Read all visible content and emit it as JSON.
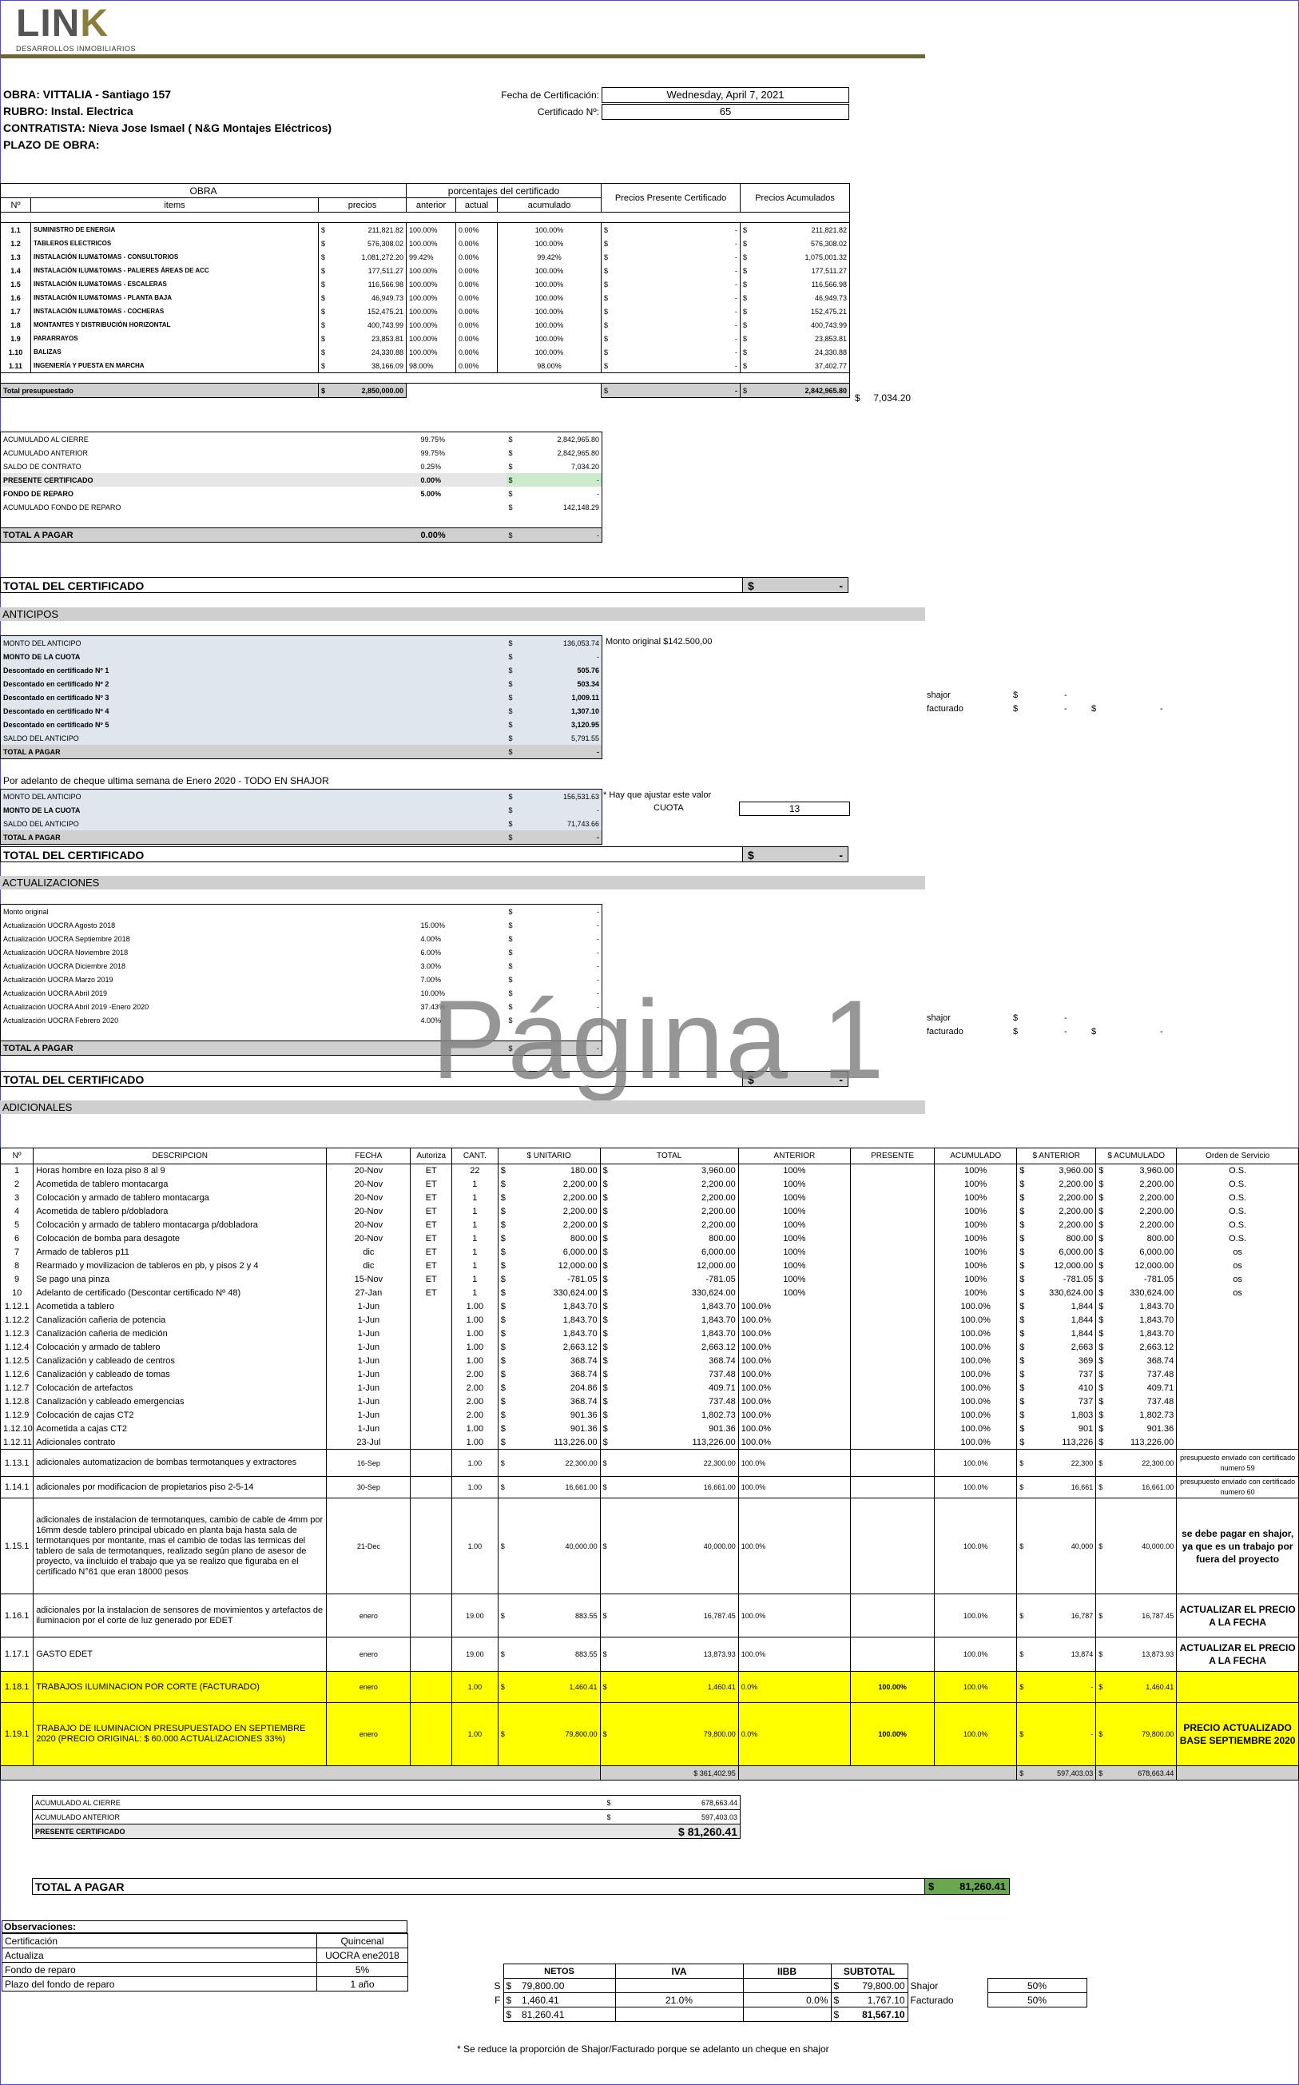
{
  "logo": {
    "name": "LINK",
    "sub": "DESARROLLOS INMOBILIARIOS"
  },
  "header": {
    "obra": "OBRA: VITTALIA - Santiago 157",
    "rubro": "RUBRO: Instal. Electrica",
    "contratista": "CONTRATISTA: Nieva Jose Ismael ( N&G Montajes Eléctricos)",
    "plazo": "PLAZO DE OBRA:",
    "fecha_label": "Fecha de Certificación:",
    "fecha": "Wednesday, April 7, 2021",
    "cert_label": "Certificado Nº:",
    "cert": "65"
  },
  "obra_table": {
    "h_obra": "OBRA",
    "h_porc": "porcentajes del certificado",
    "h_presente": "Precios Presente Certificado",
    "h_acum": "Precios Acumulados",
    "cols": [
      "Nº",
      "items",
      "precios",
      "anterior",
      "actual",
      "acumulado"
    ],
    "rows": [
      [
        "1.1",
        "SUMINISTRO DE ENERGIA",
        "211,821.82",
        "100.00%",
        "0.00%",
        "100.00%",
        "-",
        "211,821.82"
      ],
      [
        "1.2",
        "TABLEROS ELECTRICOS",
        "576,308.02",
        "100.00%",
        "0.00%",
        "100.00%",
        "-",
        "576,308.02"
      ],
      [
        "1.3",
        "INSTALACIÓN ILUM&TOMAS - CONSULTORIOS",
        "1,081,272.20",
        "99.42%",
        "0.00%",
        "99.42%",
        "-",
        "1,075,001.32"
      ],
      [
        "1.4",
        "INSTALACIÓN ILUM&TOMAS - PALIERES ÁREAS DE ACC",
        "177,511.27",
        "100.00%",
        "0.00%",
        "100.00%",
        "-",
        "177,511.27"
      ],
      [
        "1.5",
        "INSTALACIÓN ILUM&TOMAS - ESCALERAS",
        "116,566.98",
        "100.00%",
        "0.00%",
        "100.00%",
        "-",
        "116,566.98"
      ],
      [
        "1.6",
        "INSTALACIÓN ILUM&TOMAS - PLANTA BAJA",
        "46,949.73",
        "100.00%",
        "0.00%",
        "100.00%",
        "-",
        "46,949.73"
      ],
      [
        "1.7",
        "INSTALACIÓN ILUM&TOMAS - COCHERAS",
        "152,475.21",
        "100.00%",
        "0.00%",
        "100.00%",
        "-",
        "152,475.21"
      ],
      [
        "1.8",
        "MONTANTES Y DISTRIBUCIÓN HORIZONTAL",
        "400,743.99",
        "100.00%",
        "0.00%",
        "100.00%",
        "-",
        "400,743.99"
      ],
      [
        "1.9",
        "PARARRAYOS",
        "23,853.81",
        "100.00%",
        "0.00%",
        "100.00%",
        "-",
        "23,853.81"
      ],
      [
        "1.10",
        "BALIZAS",
        "24,330.88",
        "100.00%",
        "0.00%",
        "100.00%",
        "-",
        "24,330.88"
      ],
      [
        "1.11",
        "INGENIERÍA Y PUESTA EN MARCHA",
        "38,166.09",
        "98.00%",
        "0.00%",
        "98.00%",
        "-",
        "37,402.77"
      ]
    ],
    "total_label": "Total presupuestado",
    "total_precio": "2,850,000.00",
    "total_presente": "-",
    "total_acum": "2,842,965.80",
    "saldo": "7,034.20"
  },
  "resumen": [
    {
      "label": "ACUMULADO AL CIERRE",
      "pct": "99.75%",
      "amt": "2,842,965.80"
    },
    {
      "label": "ACUMULADO ANTERIOR",
      "pct": "99.75%",
      "amt": "2,842,965.80"
    },
    {
      "label": "SALDO DE CONTRATO",
      "pct": "0.25%",
      "amt": "7,034.20"
    },
    {
      "label": "PRESENTE CERTIFICADO",
      "pct": "0.00%",
      "amt": "-"
    },
    {
      "label": "FONDO DE REPARO",
      "pct": "5.00%",
      "amt": "-"
    },
    {
      "label": "ACUMULADO FONDO DE REPARO",
      "pct": "",
      "amt": "142,148.29"
    }
  ],
  "total_pagar": {
    "label": "TOTAL A PAGAR",
    "pct": "0.00%",
    "amt": "-"
  },
  "total_cert": {
    "label": "TOTAL DEL CERTIFICADO",
    "amt": "-"
  },
  "currency": "$",
  "anticipos": {
    "title": "ANTICIPOS",
    "original": "Monto original $142.500,00",
    "rows": [
      {
        "label": "MONTO DEL ANTICIPO",
        "amt": "136,053.74"
      },
      {
        "label": "MONTO DE LA CUOTA",
        "amt": "-"
      },
      {
        "label": "Descontado en certificado Nº 1",
        "amt": "505.76"
      },
      {
        "label": "Descontado en certificado Nº 2",
        "amt": "503.34"
      },
      {
        "label": "Descontado en certificado Nº 3",
        "amt": "1,009.11"
      },
      {
        "label": "Descontado en certificado Nº 4",
        "amt": "1,307.10"
      },
      {
        "label": "Descontado en certificado Nº 5",
        "amt": "3,120.95"
      },
      {
        "label": "SALDO DEL ANTICIPO",
        "amt": "5,791.55"
      },
      {
        "label": "TOTAL A PAGAR",
        "amt": "-"
      }
    ],
    "shajor": "shajor",
    "facturado": "facturado",
    "dash": "-",
    "cheque_note": "Por adelanto de cheque ultima semana de Enero 2020 - TODO EN SHAJOR",
    "rows2": [
      {
        "label": "MONTO DEL ANTICIPO",
        "amt": "156,531.63"
      },
      {
        "label": "MONTO DE LA CUOTA",
        "amt": "-"
      },
      {
        "label": "SALDO DEL ANTICIPO",
        "amt": "71,743.66"
      },
      {
        "label": "TOTAL A PAGAR",
        "amt": "-"
      }
    ],
    "ajustar": "* Hay que ajustar este valor",
    "cuota_label": "CUOTA",
    "cuota": "13",
    "total_label": "TOTAL DEL CERTIFICADO",
    "total_amt": "-"
  },
  "actualizaciones": {
    "title": "ACTUALIZACIONES",
    "rows": [
      {
        "label": "Monto original",
        "pct": "",
        "amt": "-"
      },
      {
        "label": "Actualización UOCRA Agosto 2018",
        "pct": "15.00%",
        "amt": "-"
      },
      {
        "label": "Actualización UOCRA Septiembre 2018",
        "pct": "4.00%",
        "amt": "-"
      },
      {
        "label": "Actualización UOCRA Noviembre 2018",
        "pct": "6.00%",
        "amt": "-"
      },
      {
        "label": "Actualización UOCRA Diciembre 2018",
        "pct": "3.00%",
        "amt": "-"
      },
      {
        "label": "Actualización UOCRA Marzo 2019",
        "pct": "7.00%",
        "amt": "-"
      },
      {
        "label": "Actualización UOCRA Abril 2019",
        "pct": "10.00%",
        "amt": "-"
      },
      {
        "label": "Actualización UOCRA Abril 2019 -Enero 2020",
        "pct": "37.43%",
        "amt": "-"
      },
      {
        "label": "Actualización UOCRA Febrero 2020",
        "pct": "4.00%",
        "amt": "-"
      }
    ],
    "total_label": "TOTAL A PAGAR",
    "total_amt": "-",
    "cert_label": "TOTAL DEL CERTIFICADO",
    "cert_amt": "-"
  },
  "watermark": "Página 1",
  "adicionales": {
    "title": "ADICIONALES",
    "cols": [
      "Nº",
      "DESCRIPCION",
      "FECHA",
      "Autoriza",
      "CANT.",
      "$ UNITARIO",
      "TOTAL",
      "ANTERIOR",
      "PRESENTE",
      "ACUMULADO",
      "$ ANTERIOR",
      "$ ACUMULADO",
      "Orden de Servicio"
    ],
    "rows": [
      [
        "1",
        "Horas hombre en loza piso 8 al 9",
        "20-Nov",
        "ET",
        "22",
        "180.00",
        "3,960.00",
        "100%",
        "",
        "100%",
        "3,960.00",
        "3,960.00",
        "O.S."
      ],
      [
        "2",
        "Acometida de tablero montacarga",
        "20-Nov",
        "ET",
        "1",
        "2,200.00",
        "2,200.00",
        "100%",
        "",
        "100%",
        "2,200.00",
        "2,200.00",
        "O.S."
      ],
      [
        "3",
        "Colocación y armado de tablero montacarga",
        "20-Nov",
        "ET",
        "1",
        "2,200.00",
        "2,200.00",
        "100%",
        "",
        "100%",
        "2,200.00",
        "2,200.00",
        "O.S."
      ],
      [
        "4",
        "Acometida de tablero p/dobladora",
        "20-Nov",
        "ET",
        "1",
        "2,200.00",
        "2,200.00",
        "100%",
        "",
        "100%",
        "2,200.00",
        "2,200.00",
        "O.S."
      ],
      [
        "5",
        "Colocación y armado de tablero montacarga p/dobladora",
        "20-Nov",
        "ET",
        "1",
        "2,200.00",
        "2,200.00",
        "100%",
        "",
        "100%",
        "2,200.00",
        "2,200.00",
        "O.S."
      ],
      [
        "6",
        "Colocación de bomba para desagote",
        "20-Nov",
        "ET",
        "1",
        "800.00",
        "800.00",
        "100%",
        "",
        "100%",
        "800.00",
        "800.00",
        "O.S."
      ],
      [
        "7",
        "Armado de tableros p11",
        "dic",
        "ET",
        "1",
        "6,000.00",
        "6,000.00",
        "100%",
        "",
        "100%",
        "6,000.00",
        "6,000.00",
        "os"
      ],
      [
        "8",
        "Rearmado y movilizacion de tableros en pb, y pisos 2 y 4",
        "dic",
        "ET",
        "1",
        "12,000.00",
        "12,000.00",
        "100%",
        "",
        "100%",
        "12,000.00",
        "12,000.00",
        "os"
      ],
      [
        "9",
        "Se pago una pinza",
        "15-Nov",
        "ET",
        "1",
        "-781.05",
        "-781.05",
        "100%",
        "",
        "100%",
        "-781.05",
        "-781.05",
        "os"
      ],
      [
        "10",
        "Adelanto de certificado (Descontar certificado Nº 48)",
        "27-Jan",
        "ET",
        "1",
        "330,624.00",
        "330,624.00",
        "100%",
        "",
        "100%",
        "330,624.00",
        "330,624.00",
        "os"
      ],
      [
        "1.12.1",
        "Acometida a tablero",
        "1-Jun",
        "",
        "1.00",
        "1,843.70",
        "1,843.70",
        "100.0%",
        "",
        "100.0%",
        "1,844",
        "1,843.70",
        ""
      ],
      [
        "1.12.2",
        "Canalización cañeria de potencia",
        "1-Jun",
        "",
        "1.00",
        "1,843.70",
        "1,843.70",
        "100.0%",
        "",
        "100.0%",
        "1,844",
        "1,843.70",
        ""
      ],
      [
        "1.12.3",
        "Canalización cañeria de medición",
        "1-Jun",
        "",
        "1.00",
        "1,843.70",
        "1,843.70",
        "100.0%",
        "",
        "100.0%",
        "1,844",
        "1,843.70",
        ""
      ],
      [
        "1.12.4",
        "Colocación y armado de tablero",
        "1-Jun",
        "",
        "1.00",
        "2,663.12",
        "2,663.12",
        "100.0%",
        "",
        "100.0%",
        "2,663",
        "2,663.12",
        ""
      ],
      [
        "1.12.5",
        "Canalización y cableado de centros",
        "1-Jun",
        "",
        "1.00",
        "368.74",
        "368.74",
        "100.0%",
        "",
        "100.0%",
        "369",
        "368.74",
        ""
      ],
      [
        "1.12.6",
        "Canalización y cableado de tomas",
        "1-Jun",
        "",
        "2.00",
        "368.74",
        "737.48",
        "100.0%",
        "",
        "100.0%",
        "737",
        "737.48",
        ""
      ],
      [
        "1.12.7",
        "Colocación de artefactos",
        "1-Jun",
        "",
        "2.00",
        "204.86",
        "409.71",
        "100.0%",
        "",
        "100.0%",
        "410",
        "409.71",
        ""
      ],
      [
        "1.12.8",
        "Canalización y cableado emergencias",
        "1-Jun",
        "",
        "2.00",
        "368.74",
        "737.48",
        "100.0%",
        "",
        "100.0%",
        "737",
        "737.48",
        ""
      ],
      [
        "1.12.9",
        "Colocación de cajas CT2",
        "1-Jun",
        "",
        "2.00",
        "901.36",
        "1,802.73",
        "100.0%",
        "",
        "100.0%",
        "1,803",
        "1,802.73",
        ""
      ],
      [
        "1.12.10",
        "Acometida a cajas CT2",
        "1-Jun",
        "",
        "1.00",
        "901.36",
        "901.36",
        "100.0%",
        "",
        "100.0%",
        "901",
        "901.36",
        ""
      ],
      [
        "1.12.11",
        "Adicionales contrato",
        "23-Jul",
        "",
        "1.00",
        "113,226.00",
        "113,226.00",
        "100.0%",
        "",
        "100.0%",
        "113,226",
        "113,226.00",
        ""
      ],
      [
        "1.13.1",
        "adicionales automatizacion de bombas termotanques y extractores",
        "16-Sep",
        "",
        "1.00",
        "22,300.00",
        "22,300.00",
        "100.0%",
        "",
        "100.0%",
        "22,300",
        "22,300.00",
        "presupuesto enviado con certificado numero 59"
      ],
      [
        "1.14.1",
        "adicionales por modificacion de propietarios piso 2-5-14",
        "30-Sep",
        "",
        "1.00",
        "16,661.00",
        "16,661.00",
        "100.0%",
        "",
        "100.0%",
        "16,661",
        "16,661.00",
        "presupuesto enviado con certificado numero 60"
      ],
      [
        "1.15.1",
        "adicionales de instalacion de termotanques, cambio de cable de 4mm por 16mm desde tablero principal ubicado en planta baja hasta sala de termotanques por montante, mas el cambio de todas las termicas del tablero de sala de termotanques, realizado según plano de asesor de proyecto, va iincluido el trabajo que ya se realizo que figuraba en el certificado N°61 que eran 18000 pesos",
        "21-Dec",
        "",
        "1.00",
        "40,000.00",
        "40,000.00",
        "100.0%",
        "",
        "100.0%",
        "40,000",
        "40,000.00",
        "se debe pagar en shajor, ya que es un trabajo por fuera del proyecto"
      ],
      [
        "1.16.1",
        "adicionales por la instalacion de sensores de movimientos y artefactos de iluminacion por el corte de luz generado por EDET",
        "enero",
        "",
        "19.00",
        "883.55",
        "16,787.45",
        "100.0%",
        "",
        "100.0%",
        "16,787",
        "16,787.45",
        "ACTUALIZAR EL PRECIO A LA FECHA"
      ],
      [
        "1.17.1",
        "GASTO EDET",
        "enero",
        "",
        "19.00",
        "883.55",
        "13,873.93",
        "100.0%",
        "",
        "100.0%",
        "13,874",
        "13,873.93",
        "ACTUALIZAR EL PRECIO A LA FECHA"
      ],
      [
        "1.18.1",
        "TRABAJOS ILUMINACION POR CORTE (FACTURADO)",
        "enero",
        "",
        "1.00",
        "1,460.41",
        "1,460.41",
        "0.0%",
        "100.00%",
        "100.0%",
        "-",
        "1,460.41",
        ""
      ],
      [
        "1.19.1",
        "TRABAJO DE ILUMINACION PRESUPUESTADO EN SEPTIEMBRE 2020 (PRECIO ORIGINAL: $ 60.000 ACTUALIZACIONES 33%)",
        "enero",
        "",
        "1.00",
        "79,800.00",
        "79,800.00",
        "0.0%",
        "100.00%",
        "100.0%",
        "-",
        "79,800.00",
        "PRECIO ACTUALIZADO BASE SEPTIEMBRE 2020"
      ]
    ],
    "tot_total": "$ 361,402.95",
    "tot_anterior": "597,403.03",
    "tot_acum": "678,663.44"
  },
  "adic_sum": [
    {
      "label": "ACUMULADO AL CIERRE",
      "amt": "678,663.44"
    },
    {
      "label": "ACUMULADO ANTERIOR",
      "amt": "597,403.03"
    },
    {
      "label": "PRESENTE CERTIFICADO",
      "amt": "$ 81,260.41"
    }
  ],
  "final_total": {
    "label": "TOTAL A PAGAR",
    "amt": "81,260.41"
  },
  "observaciones": {
    "title": "Observaciones:",
    "rows": [
      [
        "Certificación",
        "Quincenal"
      ],
      [
        "Actualiza",
        "UOCRA ene2018"
      ],
      [
        "Fondo de reparo",
        "5%"
      ],
      [
        "Plazo del fondo de reparo",
        "1 año"
      ]
    ]
  },
  "split": {
    "cols": [
      "NETOS",
      "IVA",
      "IIBB",
      "SUBTOTAL"
    ],
    "rows": [
      {
        "k": "S",
        "netos": "79,800.00",
        "iva": "",
        "iibb": "",
        "sub": "79,800.00",
        "name": "Shajor",
        "pct": "50%"
      },
      {
        "k": "F",
        "netos": "1,460.41",
        "iva": "21.0%",
        "iibb": "0.0%",
        "sub": "1,767.10",
        "name": "Facturado",
        "pct": "50%"
      },
      {
        "k": "",
        "netos": "81,260.41",
        "iva": "",
        "iibb": "",
        "sub": "81,567.10",
        "name": "",
        "pct": ""
      }
    ],
    "note": "* Se reduce la proporción de Shajor/Facturado porque se adelanto un cheque en shajor"
  }
}
